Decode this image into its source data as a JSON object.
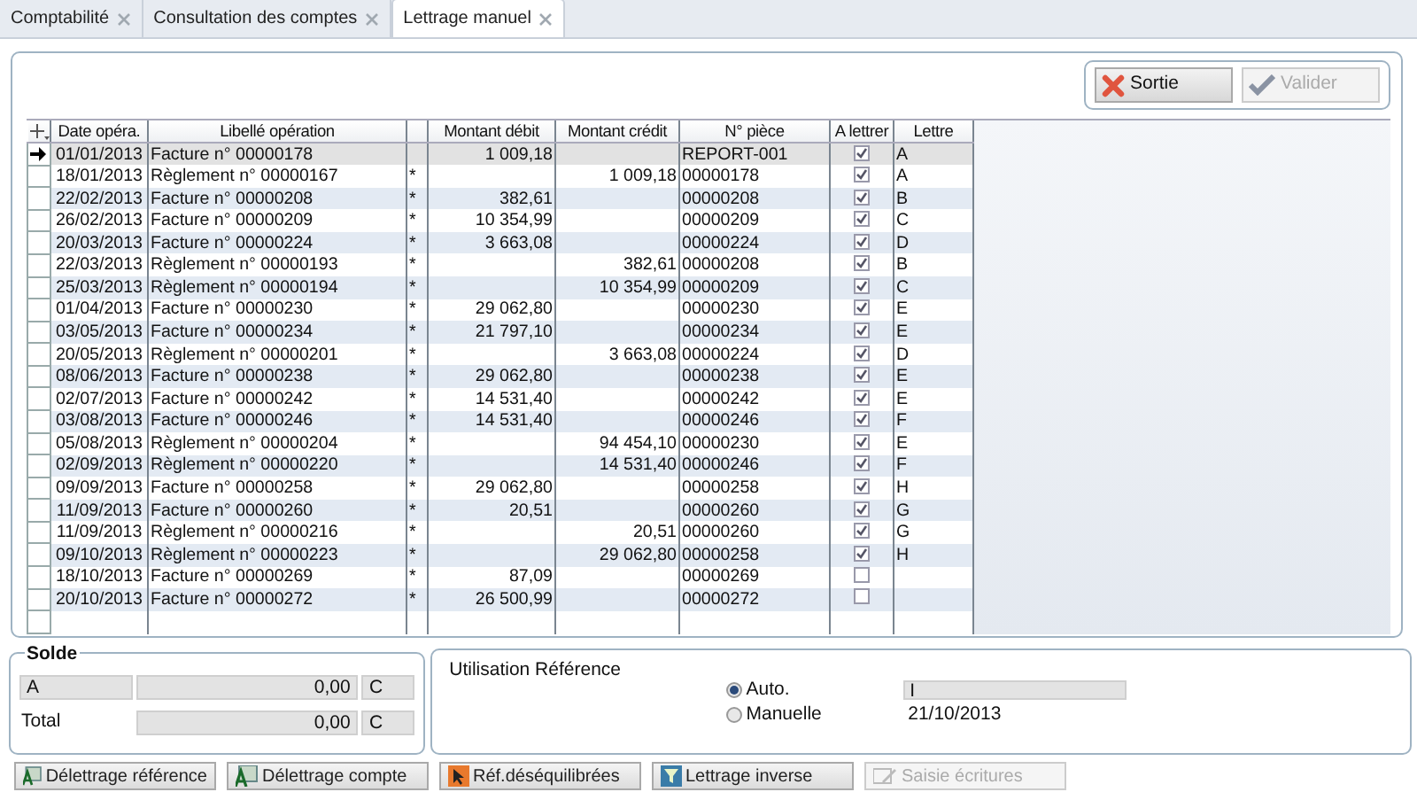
{
  "tabs": [
    {
      "label": "Comptabilité",
      "selected": false
    },
    {
      "label": "Consultation des comptes",
      "selected": false
    },
    {
      "label": "Lettrage manuel",
      "selected": true
    }
  ],
  "actions": [
    {
      "label": "Sortie",
      "kind": "exit",
      "disabled": false
    },
    {
      "label": "Valider",
      "kind": "validate",
      "disabled": true
    }
  ],
  "table": {
    "columns": [
      "Date opéra.",
      "Libellé opération",
      "",
      "Montant débit",
      "Montant crédit",
      "N° pièce",
      "A lettrer",
      "Lettre"
    ],
    "rows": [
      {
        "date": "01/01/2013",
        "label": "Facture n° 00000178",
        "debit": "1 009,18",
        "credit": "",
        "piece": "REPORT-001",
        "checked": true,
        "letter": "A",
        "selected": true
      },
      {
        "date": "18/01/2013",
        "label": "Règlement n° 00000167",
        "star": "*",
        "debit": "",
        "credit": "1 009,18",
        "piece": "00000178",
        "checked": true,
        "letter": "A",
        "selected": false
      },
      {
        "date": "22/02/2013",
        "label": "Facture n° 00000208",
        "star": "*",
        "debit": "382,61",
        "credit": "",
        "piece": "00000208",
        "checked": true,
        "letter": "B",
        "selected": false
      },
      {
        "date": "26/02/2013",
        "label": "Facture n° 00000209",
        "star": "*",
        "debit": "10 354,99",
        "credit": "",
        "piece": "00000209",
        "checked": true,
        "letter": "C",
        "selected": false
      },
      {
        "date": "20/03/2013",
        "label": "Facture n° 00000224",
        "star": "*",
        "debit": "3 663,08",
        "credit": "",
        "piece": "00000224",
        "checked": true,
        "letter": "D",
        "selected": false
      },
      {
        "date": "22/03/2013",
        "label": "Règlement n° 00000193",
        "star": "*",
        "debit": "",
        "credit": "382,61",
        "piece": "00000208",
        "checked": true,
        "letter": "B",
        "selected": false
      },
      {
        "date": "25/03/2013",
        "label": "Règlement n° 00000194",
        "star": "*",
        "debit": "",
        "credit": "10 354,99",
        "piece": "00000209",
        "checked": true,
        "letter": "C",
        "selected": false
      },
      {
        "date": "01/04/2013",
        "label": "Facture n° 00000230",
        "star": "*",
        "debit": "29 062,80",
        "credit": "",
        "piece": "00000230",
        "checked": true,
        "letter": "E",
        "selected": false
      },
      {
        "date": "03/05/2013",
        "label": "Facture n° 00000234",
        "star": "*",
        "debit": "21 797,10",
        "credit": "",
        "piece": "00000234",
        "checked": true,
        "letter": "E",
        "selected": false
      },
      {
        "date": "20/05/2013",
        "label": "Règlement n° 00000201",
        "star": "*",
        "debit": "",
        "credit": "3 663,08",
        "piece": "00000224",
        "checked": true,
        "letter": "D",
        "selected": false
      },
      {
        "date": "08/06/2013",
        "label": "Facture n° 00000238",
        "star": "*",
        "debit": "29 062,80",
        "credit": "",
        "piece": "00000238",
        "checked": true,
        "letter": "E",
        "selected": false
      },
      {
        "date": "02/07/2013",
        "label": "Facture n° 00000242",
        "star": "*",
        "debit": "14 531,40",
        "credit": "",
        "piece": "00000242",
        "checked": true,
        "letter": "E",
        "selected": false
      },
      {
        "date": "03/08/2013",
        "label": "Facture n° 00000246",
        "star": "*",
        "debit": "14 531,40",
        "credit": "",
        "piece": "00000246",
        "checked": true,
        "letter": "F",
        "selected": false
      },
      {
        "date": "05/08/2013",
        "label": "Règlement n° 00000204",
        "star": "*",
        "debit": "",
        "credit": "94 454,10",
        "piece": "00000230",
        "checked": true,
        "letter": "E",
        "selected": false
      },
      {
        "date": "02/09/2013",
        "label": "Règlement n° 00000220",
        "star": "*",
        "debit": "",
        "credit": "14 531,40",
        "piece": "00000246",
        "checked": true,
        "letter": "F",
        "selected": false
      },
      {
        "date": "09/09/2013",
        "label": "Facture n° 00000258",
        "star": "*",
        "debit": "29 062,80",
        "credit": "",
        "piece": "00000258",
        "checked": true,
        "letter": "H",
        "selected": false
      },
      {
        "date": "11/09/2013",
        "label": "Facture n° 00000260",
        "star": "*",
        "debit": "20,51",
        "credit": "",
        "piece": "00000260",
        "checked": true,
        "letter": "G",
        "selected": false
      },
      {
        "date": "11/09/2013",
        "label": "Règlement n° 00000216",
        "star": "*",
        "debit": "",
        "credit": "20,51",
        "piece": "00000260",
        "checked": true,
        "letter": "G",
        "selected": false
      },
      {
        "date": "09/10/2013",
        "label": "Règlement n° 00000223",
        "star": "*",
        "debit": "",
        "credit": "29 062,80",
        "piece": "00000258",
        "checked": true,
        "letter": "H",
        "selected": false
      },
      {
        "date": "18/10/2013",
        "label": "Facture n° 00000269",
        "star": "*",
        "debit": "87,09",
        "credit": "",
        "piece": "00000269",
        "checked": false,
        "letter": "",
        "selected": false
      },
      {
        "date": "20/10/2013",
        "label": "Facture n° 00000272",
        "star": "*",
        "debit": "26 500,99",
        "credit": "",
        "piece": "00000272",
        "checked": false,
        "letter": "",
        "selected": false
      }
    ]
  },
  "solde": {
    "title": "Solde",
    "rows": [
      {
        "label": "A",
        "amount": "0,00",
        "side": "C",
        "kind": "field"
      },
      {
        "label": "Total",
        "amount": "0,00",
        "side": "C",
        "kind": "text"
      }
    ]
  },
  "reference": {
    "title": "Utilisation Référence",
    "options": [
      {
        "label": "Auto.",
        "selected": true,
        "value": "I",
        "kind": "field"
      },
      {
        "label": "Manuelle",
        "selected": false,
        "value": "21/10/2013",
        "kind": "text"
      }
    ]
  },
  "bottom_buttons": [
    {
      "label": "Délettrage référence",
      "kind": "unletter",
      "disabled": false
    },
    {
      "label": "Délettrage compte",
      "kind": "unletter",
      "disabled": false
    },
    {
      "label": "Réf.déséquilibrées",
      "kind": "unbalanced",
      "disabled": false
    },
    {
      "label": "Lettrage inverse",
      "kind": "funnel",
      "disabled": false
    },
    {
      "label": "Saisie écritures",
      "kind": "entry",
      "disabled": true
    }
  ]
}
